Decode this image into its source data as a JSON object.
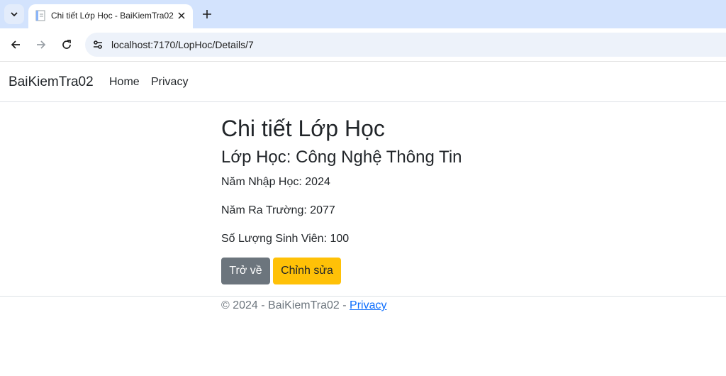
{
  "browser": {
    "tab_title": "Chi tiết Lớp Học - BaiKiemTra02",
    "url": "localhost:7170/LopHoc/Details/7"
  },
  "navbar": {
    "brand": "BaiKiemTra02",
    "links": [
      "Home",
      "Privacy"
    ]
  },
  "main": {
    "page_title": "Chi tiết Lớp Học",
    "class_title": "Lớp Học: Công Nghệ Thông Tin",
    "details": [
      "Năm Nhập Học: 2024",
      "Năm Ra Trường: 2077",
      "Số Lượng Sinh Viên: 100"
    ],
    "buttons": {
      "back": "Trở về",
      "edit": "Chỉnh sửa"
    }
  },
  "footer": {
    "text": "© 2024 - BaiKiemTra02 - ",
    "link": "Privacy"
  },
  "colors": {
    "back_button": "#6c757d",
    "edit_button": "#ffc107",
    "link": "#0d6efd",
    "tabbar": "#d3e3fd"
  },
  "icons": [
    "tab-list-icon",
    "page-favicon-icon",
    "close-icon",
    "plus-icon",
    "back-arrow-icon",
    "forward-arrow-icon",
    "reload-icon",
    "site-info-icon"
  ]
}
